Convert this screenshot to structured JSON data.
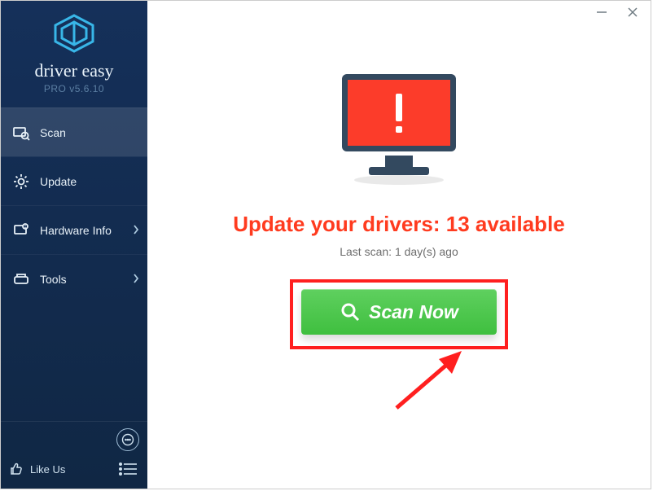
{
  "brand": {
    "name": "driver easy",
    "sub": "PRO v5.6.10"
  },
  "sidebar": {
    "items": [
      {
        "label": "Scan",
        "active": true,
        "hasChevron": false
      },
      {
        "label": "Update",
        "active": false,
        "hasChevron": false
      },
      {
        "label": "Hardware Info",
        "active": false,
        "hasChevron": true
      },
      {
        "label": "Tools",
        "active": false,
        "hasChevron": true
      }
    ],
    "like_label": "Like Us"
  },
  "main": {
    "headline_prefix": "Update your drivers: ",
    "headline_count": "13",
    "headline_suffix": " available",
    "last_scan": "Last scan: 1 day(s) ago",
    "scan_button_label": "Scan Now"
  },
  "colors": {
    "accent_red": "#ff3b1f",
    "sidebar_bg": "#122a4c",
    "button_green": "#45c445"
  }
}
